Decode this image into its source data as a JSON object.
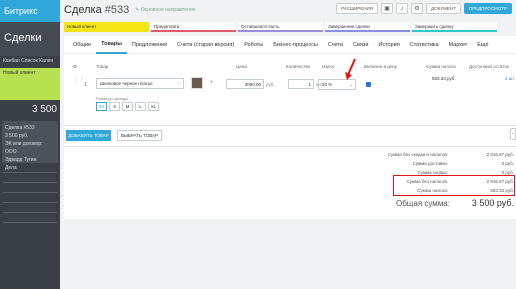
{
  "bg": {
    "brand": "Битрикс",
    "header": "Сделки",
    "tabs": "Канбан  Список  Кален",
    "column": "Новый клиент",
    "column_sum": "3 500",
    "card_title": "Сделка #533",
    "card_sum": "3 500 руб.",
    "card_company": "ЭК или договор: ООО",
    "card_contact": "Эдвард Тугин",
    "card_action": "Дела"
  },
  "panel": {
    "title": "Сделка",
    "number": "#533",
    "direction": "Основное направление",
    "actions": [
      "РАСШИРЕНИЯ",
      "ДОКУМЕНТ",
      "ПРЕДПРОСМОТР"
    ]
  },
  "stages": [
    "Новый клиент",
    "Предоплата",
    "Оставшаяся часть",
    "Завершение сделки",
    "Завершить сделку"
  ],
  "tabs": [
    {
      "label": "Общие"
    },
    {
      "label": "Товары",
      "active": true
    },
    {
      "label": "Предложения"
    },
    {
      "label": "Счета (старая версия)"
    },
    {
      "label": "Роботы"
    },
    {
      "label": "Бизнес-процессы"
    },
    {
      "label": "Счета"
    },
    {
      "label": "Связи"
    },
    {
      "label": "История"
    },
    {
      "label": "Статистика"
    },
    {
      "label": "Маркет"
    },
    {
      "label": "Ещё"
    }
  ],
  "table_headers": {
    "product": "Товар",
    "price": "Цена",
    "quantity": "Количество",
    "tax": "Налог",
    "tax_included": "Включен в цену",
    "tax_sum": "Сумма налога",
    "stock": "Доступный остаток"
  },
  "row": {
    "num": "1",
    "name": "Шелковое черное платье",
    "price": "3000.00",
    "currency": "руб.",
    "qty": "1",
    "unit": "шт",
    "tax": "20 %",
    "tax_sum": "583.33 руб.",
    "stock": "2 шт",
    "sizes_label": "Размеры одежды",
    "sizes": [
      "XS",
      "S",
      "M",
      "L",
      "XL"
    ]
  },
  "buttons": {
    "add": "ДОБАВИТЬ ТОВАР",
    "select": "ВЫБРАТЬ ТОВАР"
  },
  "totals": [
    {
      "label": "Сумма без скидки и налогов:",
      "value": "2 916.67 руб."
    },
    {
      "label": "Сумма доставки:",
      "value": "0 руб."
    },
    {
      "label": "Сумма скидки:",
      "value": "0 руб."
    },
    {
      "label": "Сумма без налогов:",
      "value": "2 916.67 руб."
    },
    {
      "label": "Сумма налога:",
      "value": "583.33 руб."
    }
  ],
  "grand_total": {
    "label": "Общая сумма:",
    "value": "3 500 руб."
  },
  "colors": {
    "accent": "#2fa7d8",
    "highlight": "#e01818",
    "stage_new": "#f6e615"
  }
}
